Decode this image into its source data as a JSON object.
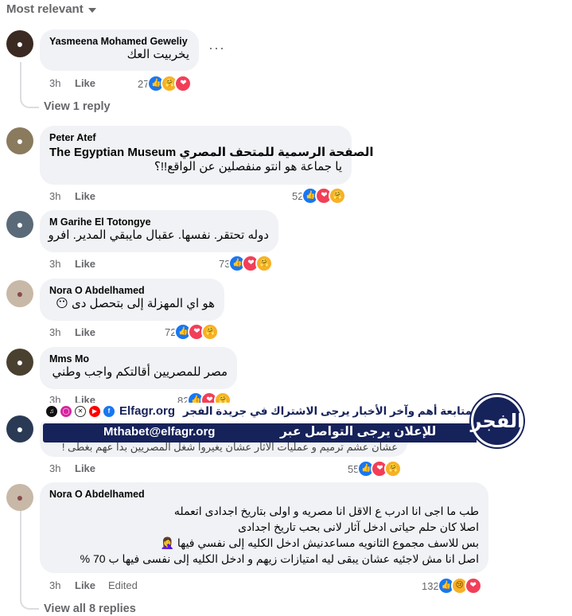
{
  "sort_label": "Most relevant",
  "comments": [
    {
      "author": "Yasmeena Mohamed Geweliy",
      "lines": [
        "يخربيت العك"
      ],
      "time": "3h",
      "like": "Like",
      "reaction_count": "27",
      "view_replies": "View 1 reply"
    },
    {
      "author": "Peter Atef",
      "tag": "The Egyptian Museum الصفحة الرسمية للمتحف المصري",
      "lines": [
        "يا جماعة هو انتو منفصلين عن الواقع!!؟"
      ],
      "time": "3h",
      "like": "Like",
      "reaction_count": "52"
    },
    {
      "author": "M Garihe El Totongye",
      "lines": [
        "دوله تحتقر. نفسها. عقبال مايبقي المدير. افرو"
      ],
      "time": "3h",
      "like": "Like",
      "reaction_count": "73"
    },
    {
      "author": "Nora O Abdelhamed",
      "lines": [
        "هو اي المهزلة إلى بتحصل دى 😶"
      ],
      "time": "3h",
      "like": "Like",
      "reaction_count": "72"
    },
    {
      "author": "Mms Mo",
      "lines": [
        "مصر للمصريين أقالتكم واجب وطني"
      ],
      "time": "3h",
      "like": "Like",
      "reaction_count": "82"
    },
    {
      "lines": [
        "عشان عشم ترميم و عمليات الآثار عشان يغيروا شغل المصريين بدا عهم بغطى !"
      ],
      "time": "3h",
      "like": "Like",
      "reaction_count": "55"
    },
    {
      "author": "Nora O Abdelhamed",
      "lines": [
        "طب ما اجى انا ادرب ع الاقل انا مصريه و اولى بتاريخ اجدادى اتعمله",
        "اصلا كان حلم حياتى ادخل آثار لانى بحب تاريخ اجدادى",
        "بس للاسف مجموع الثانويه مساعدنيش ادخل الكليه إلى نفسي فيها 🤦‍♀️",
        "اصل انا مش لاجئيه عشان يبقى ليه امتيازات زيهم و ادخل الكليه إلى نفسى فيها ب 70 %"
      ],
      "time": "3h",
      "like": "Like",
      "edited": "Edited",
      "reaction_count": "132"
    }
  ],
  "view_all_replies": "View all 8 replies",
  "banner": {
    "site": "Elfagr.org",
    "top_text": "لمتابعة أهم وآخر الأخبار يرجى الاشتراك في جريدة الفجر",
    "email": "Mthabet@elfagr.org",
    "bottom_text": "للإعلان يرجى التواصل عبر",
    "logo_text": "الفجر",
    "social_icons": [
      "tiktok-icon",
      "instagram-icon",
      "x-icon",
      "youtube-icon",
      "facebook-icon"
    ]
  },
  "colors": {
    "like_blue": "#1877f2",
    "love_red": "#f33e58",
    "care_yellow": "#f7b125",
    "banner_navy": "#16225a"
  }
}
